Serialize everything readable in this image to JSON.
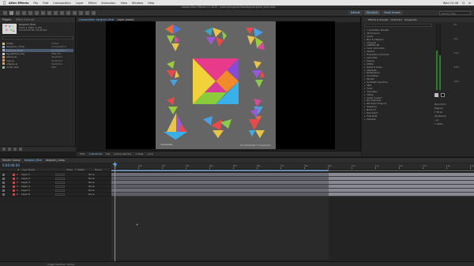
{
  "menubar": {
    "apple": "",
    "items": [
      "After Effects",
      "File",
      "Edit",
      "Composition",
      "Layer",
      "Effect",
      "Animation",
      "View",
      "Window",
      "Help"
    ],
    "right_items": [
      "Wed 10:38",
      "Q",
      "≡"
    ]
  },
  "app_title": "Adobe After Effects CC 2015 - /Users/tangram/Desktop/tangram_anim.aep",
  "toolbar": {
    "workspaces": [
      "Default",
      "Standard",
      "Small Screen"
    ],
    "selected_workspace": "Standard",
    "search_placeholder": "Search Help"
  },
  "project_panel": {
    "tabs": [
      "Project",
      "Effect Controls"
    ],
    "item_name": "tangram_final",
    "item_info_1": "1920 x 1080 (1.00)",
    "item_info_2": "Δ 0:00:10:00, 25.00 fps",
    "items": [
      {
        "name": "Solids",
        "type": "Folder",
        "color": "#d8c85a",
        "selected": false
      },
      {
        "name": "tangram_comp",
        "type": "Composition",
        "color": "#9ab0d8",
        "selected": false
      },
      {
        "name": "tangram_final",
        "type": "Composition",
        "color": "#9ab0d8",
        "selected": true
      },
      {
        "name": "bg_texture.png",
        "type": "PNG file",
        "color": "#c9c9c9",
        "selected": false
      },
      {
        "name": "pieces.ai",
        "type": "Illustrator",
        "color": "#e6a04a",
        "selected": false
      },
      {
        "name": "logo.ai",
        "type": "Illustrator",
        "color": "#e6a04a",
        "selected": false
      },
      {
        "name": "shapes.ai",
        "type": "Illustrator",
        "color": "#e6a04a",
        "selected": false
      },
      {
        "name": "music.wav",
        "type": "WAV",
        "color": "#8ac48a",
        "selected": false
      }
    ]
  },
  "viewer": {
    "tabs": [
      "Composition: tangram_final",
      "Layer: (none)"
    ],
    "caption_left": "dreamstime",
    "caption_right": "ID 00000000 © Illustrator",
    "footer": {
      "zoom": "50%",
      "timecode": "0:00:00:00",
      "resolution": "Full",
      "camera": "Active Camera",
      "views": "1 View",
      "offset": "+0.0"
    }
  },
  "right_panel": {
    "tabs": [
      "Effects & Presets",
      "Character",
      "Paragraph"
    ],
    "effects": [
      "* Animation Presets",
      "3D Channel",
      "Audio",
      "Blur & Sharpen",
      "Channel",
      "CINEMA 4D",
      "Color Correction",
      "Distort",
      "Expression Controls",
      "Generate",
      "Keying",
      "Matte",
      "Noise & Grain",
      "Obsolete",
      "Perspective",
      "Simulation",
      "Stylize",
      "Synthetic Aperture",
      "Text",
      "Time",
      "Transition",
      "Utility",
      "Video Copilot",
      "RG Trapcode",
      "RE:Vision Plug-ins",
      "Sapphire",
      "Boris FX",
      "Red Giant",
      "Frischluft",
      "GenArts"
    ],
    "audio_labels": [
      "0.0",
      "-6.0",
      "-12.0",
      "-18.0",
      "-24.0"
    ],
    "character_rows": [
      "Myriad Pro",
      "Regular",
      "T 36 px",
      "VA Metrics",
      "- px",
      "T 100%"
    ]
  },
  "timeline": {
    "tabs": [
      "Render Queue",
      "tangram_final",
      "tangram_comp"
    ],
    "selected_tab": "tangram_final",
    "timecode": "0:00:00:00",
    "columns": [
      "#",
      "Layer Name",
      "Mode",
      "T TrkMat",
      "Parent"
    ],
    "layers": [
      {
        "num": "1",
        "name": "Layer 1",
        "parent": "None",
        "color": "#c04a4a"
      },
      {
        "num": "2",
        "name": "Layer 2",
        "parent": "None",
        "color": "#c04a4a"
      },
      {
        "num": "3",
        "name": "Layer 3",
        "parent": "None",
        "color": "#c04a4a"
      },
      {
        "num": "4",
        "name": "Layer 4",
        "parent": "None",
        "color": "#c04a4a"
      },
      {
        "num": "5",
        "name": "Layer 5",
        "parent": "None",
        "color": "#c04a4a"
      },
      {
        "num": "6",
        "name": "Layer 6",
        "parent": "None",
        "color": "#c04a4a"
      }
    ],
    "ruler_ticks": [
      "0s",
      "01s",
      "02s",
      "03s",
      "04s",
      "05s",
      "06s",
      "07s",
      "08s",
      "09s",
      "10s",
      "11s",
      "12s",
      "13s",
      "14s",
      "15s"
    ],
    "footer_left": "Toggle Switches / Modes"
  },
  "colors": {
    "accent": "#5aa0e6",
    "timecode": "#7fc0ff",
    "layer_bar": "#6d6d78",
    "comp_bg": "#656565"
  }
}
